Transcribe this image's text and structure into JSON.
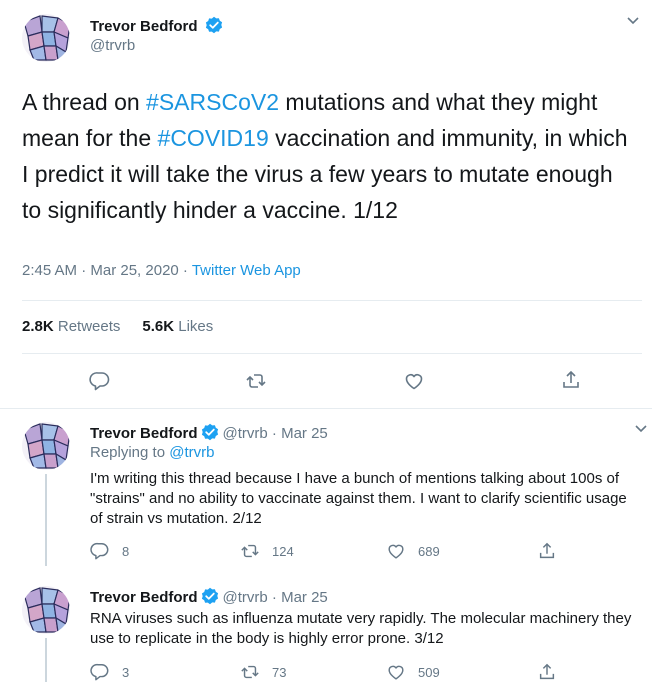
{
  "colors": {
    "link": "#1b95e0",
    "muted": "#657786",
    "verified": "#1da1f2",
    "text": "#14171a"
  },
  "main_tweet": {
    "author_name": "Trevor Bedford",
    "author_handle": "@trvrb",
    "text_parts": [
      "A thread on ",
      "#SARSCoV2",
      " mutations and what they might mean for the ",
      "#COVID19",
      " vaccination and immunity, in which I predict it will take the virus a few years to mutate enough to significantly hinder a vaccine. 1/12"
    ],
    "timestamp": "2:45 AM · Mar 25, 2020 · ",
    "source_app": "Twitter Web App",
    "retweets_count": "2.8K",
    "retweets_label": "Retweets",
    "likes_count": "5.6K",
    "likes_label": "Likes",
    "actions": [
      "reply-icon",
      "retweet-icon",
      "like-icon",
      "share-icon"
    ]
  },
  "replies": [
    {
      "author_name": "Trevor Bedford",
      "author_handle": "@trvrb · Mar 25",
      "replying_prefix": "Replying to ",
      "replying_to": "@trvrb",
      "text": "I'm writing this thread because I have a bunch of mentions talking about 100s of \"strains\" and no ability to vaccinate against them. I want to clarify scientific usage of strain vs mutation. 2/12",
      "reply_count": "8",
      "retweet_count": "124",
      "like_count": "689"
    },
    {
      "author_name": "Trevor Bedford",
      "author_handle": "@trvrb · Mar 25",
      "text": "RNA viruses such as influenza mutate very rapidly. The molecular machinery they use to replicate in the body is highly error prone. 3/12",
      "reply_count": "3",
      "retweet_count": "73",
      "like_count": "509"
    }
  ]
}
